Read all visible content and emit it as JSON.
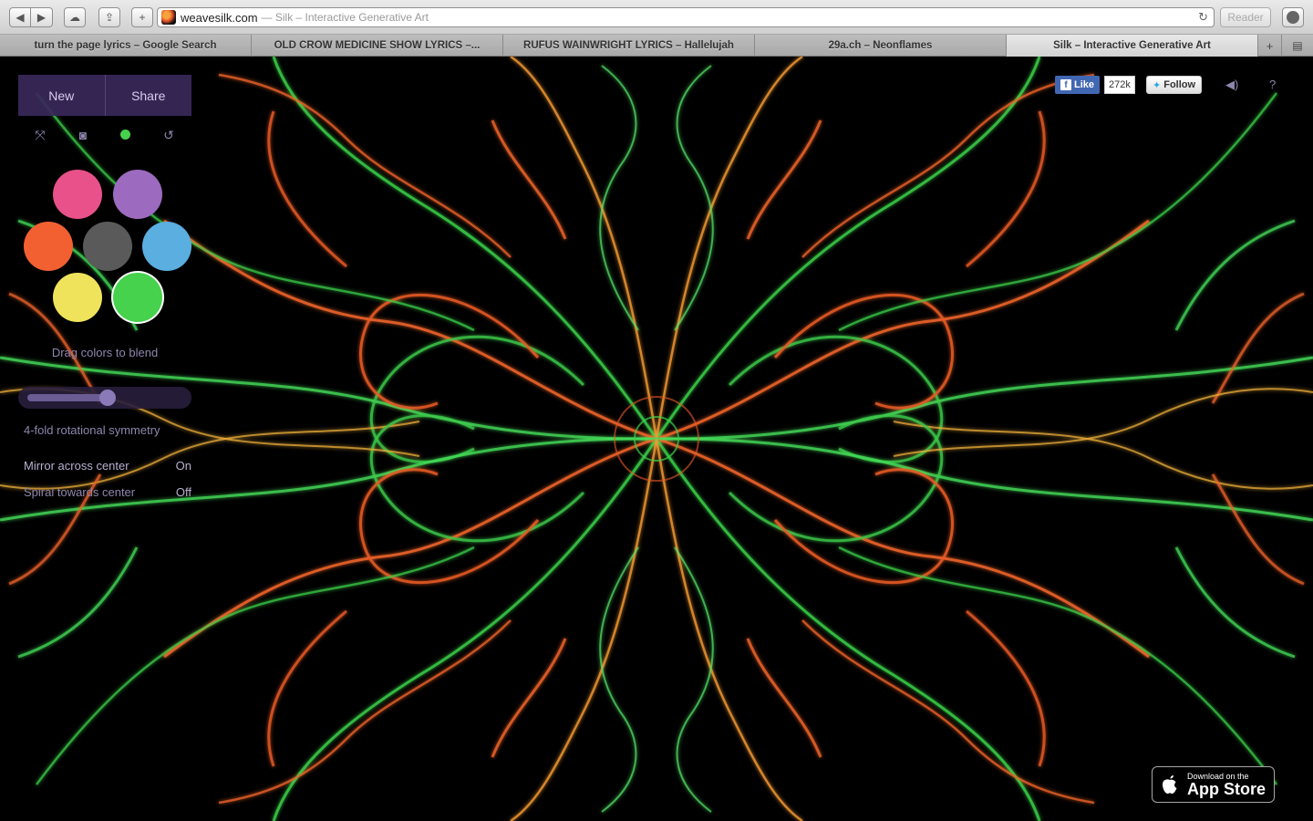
{
  "browser": {
    "domain": "weavesilk.com",
    "page_title": "— Silk – Interactive Generative Art",
    "reader_label": "Reader",
    "tabs": [
      {
        "label": "turn the page lyrics – Google Search",
        "active": false
      },
      {
        "label": "OLD CROW MEDICINE SHOW LYRICS –...",
        "active": false
      },
      {
        "label": "RUFUS WAINWRIGHT LYRICS – Hallelujah",
        "active": false
      },
      {
        "label": "29a.ch – Neonflames",
        "active": false
      },
      {
        "label": "Silk – Interactive Generative Art",
        "active": true
      }
    ]
  },
  "silk": {
    "new_label": "New",
    "share_label": "Share",
    "colors": {
      "pink": "#e8518a",
      "purple": "#9c6bc0",
      "orange": "#f26032",
      "gray": "#5a5a5a",
      "blue": "#5aaee0",
      "yellow": "#f0e35c",
      "green": "#46d24c"
    },
    "selected_color": "green",
    "drag_hint": "Drag colors to blend",
    "symmetry_label": "4-fold rotational symmetry",
    "symmetry_level": 0.45,
    "mirror_label": "Mirror across center",
    "mirror_value": "On",
    "spiral_label": "Spiral towards center",
    "spiral_value": "Off"
  },
  "social": {
    "like_label": "Like",
    "like_count": "272k",
    "follow_label": "Follow",
    "help_label": "?"
  },
  "appstore": {
    "small": "Download on the",
    "big": "App Store"
  }
}
